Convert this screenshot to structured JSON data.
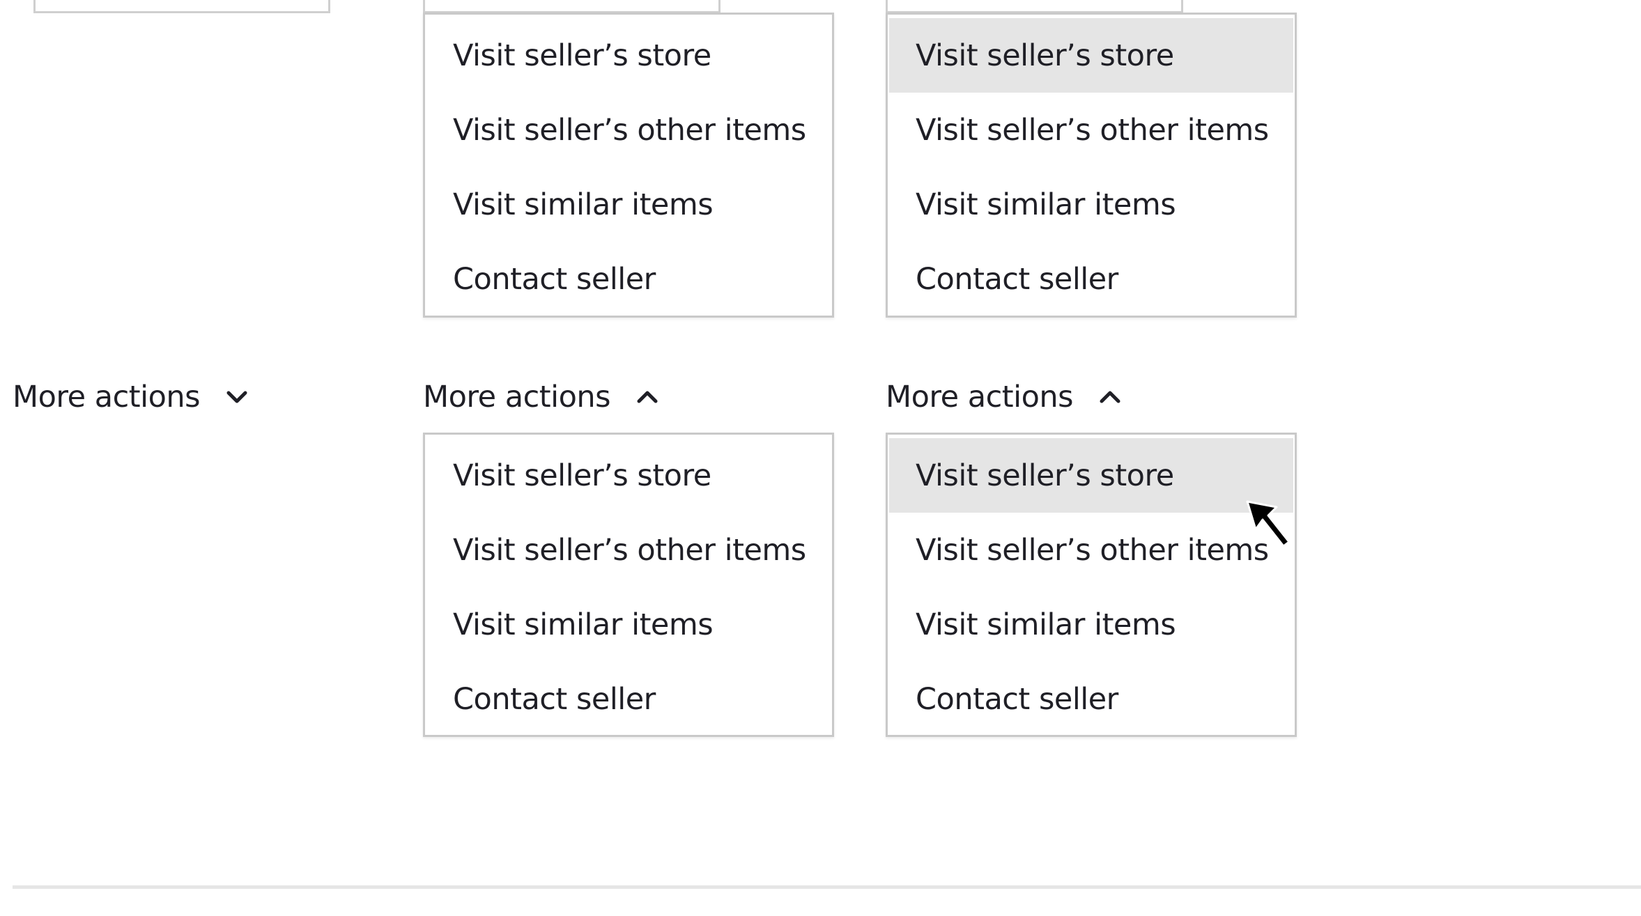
{
  "trigger_label": "More actions",
  "menu_items": [
    "Visit seller’s store",
    "Visit seller’s other items",
    "Visit similar items",
    "Contact seller"
  ],
  "colors": {
    "text": "#1f1f26",
    "border": "#c9c9c9",
    "hover": "#e5e5e5",
    "divider": "#e6e6e6"
  },
  "icons": {
    "closed": "chevron-down-icon",
    "open": "chevron-up-icon",
    "cursor": "mouse-pointer-icon"
  }
}
